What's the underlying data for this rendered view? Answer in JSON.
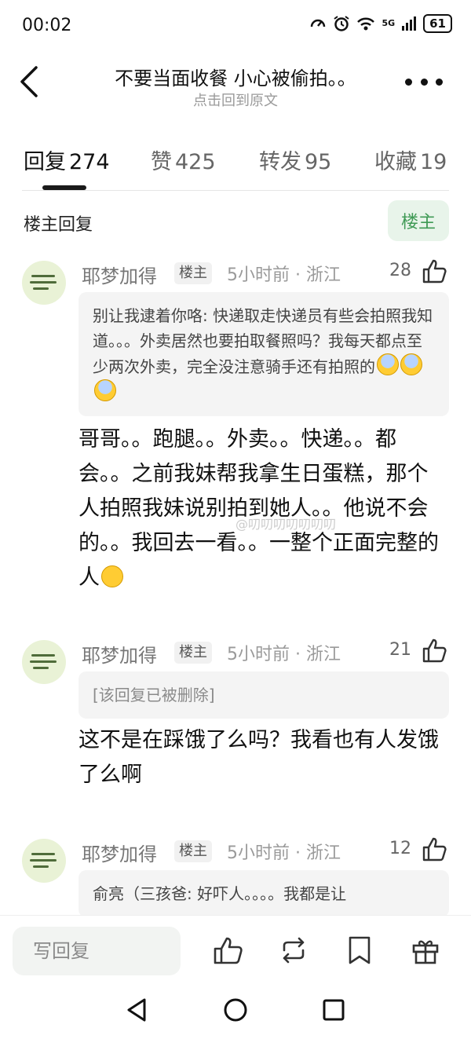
{
  "status_bar": {
    "time": "00:02",
    "battery": "61",
    "network": "5G"
  },
  "nav": {
    "title": "不要当面收餐 小心被偷拍。。",
    "subtitle": "点击回到原文"
  },
  "tabs": [
    {
      "label": "回复",
      "count": "274"
    },
    {
      "label": "赞",
      "count": "425"
    },
    {
      "label": "转发",
      "count": "95"
    },
    {
      "label": "收藏",
      "count": "19"
    }
  ],
  "section": {
    "title": "楼主回复",
    "op_button": "楼主"
  },
  "comments": [
    {
      "name": "耶梦加得",
      "tag": "楼主",
      "meta": "5小时前 · 浙江",
      "likes": "28",
      "quote": "别让我逮着你咯: 快递取走快递员有些会拍照我知道。。。外卖居然也要拍取餐照吗？我每天都点至少两次外卖，完全没注意骑手还有拍照的",
      "body": "哥哥。。跑腿。。外卖。。快递。。都会。。之前我妹帮我拿生日蛋糕，那个人拍照我妹说别拍到她人。。他说不会的。。我回去一看。。一整个正面完整的人"
    },
    {
      "name": "耶梦加得",
      "tag": "楼主",
      "meta": "5小时前 · 浙江",
      "likes": "21",
      "quote": "[该回复已被删除]",
      "body": "这不是在踩饿了么吗？我看也有人发饿了么啊"
    },
    {
      "name": "耶梦加得",
      "tag": "楼主",
      "meta": "5小时前 · 浙江",
      "likes": "12",
      "quote": "俞亮（三孩爸: 好吓人。。。。我都是让"
    }
  ],
  "watermark": "@叨叨叨叨叨叨叨",
  "bottom_bar": {
    "reply_placeholder": "写回复"
  },
  "colors": {
    "accent_green": "#3f9a55",
    "op_button_bg": "#e8f4ea"
  },
  "icons": [
    "back-icon",
    "more-icon",
    "like-icon",
    "repost-icon",
    "bookmark-icon",
    "gift-icon"
  ]
}
